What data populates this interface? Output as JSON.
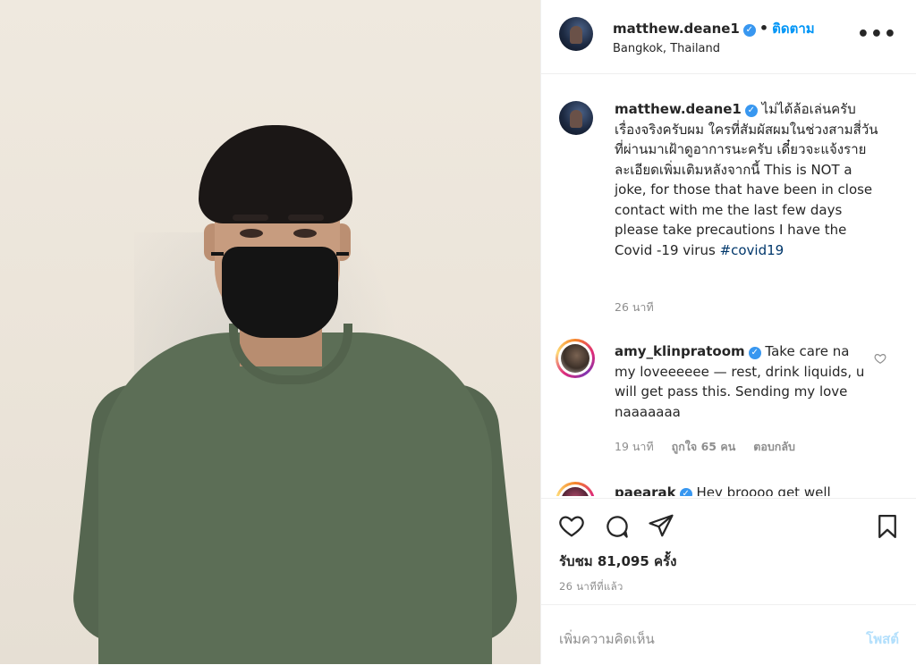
{
  "post": {
    "username": "matthew.deane1",
    "follow_label": "ติดตาม",
    "separator": "•",
    "location": "Bangkok, Thailand",
    "more_label": "•••",
    "caption_prefix": "ไม่ได้ล้อเล่นครับ เรื่องจริงครับผม ใครที่สัมผัสผมในช่วงสามสี่วันที่ผ่านมาเฝ้าดูอาการนะครับ เดี๋ยวจะแจ้งรายละเอียดเพิ่มเติมหลังจากนี้ This is NOT a joke, for those that have been in close contact with me the last few days please take precautions I have the Covid -19 virus ",
    "hashtag": "#covid19",
    "caption_time": "26 นาที",
    "verified_icon": "✓"
  },
  "comments": [
    {
      "username": "amy_klinpratoom",
      "text": "Take care na my loveeeeee — rest, drink liquids, u will get pass this. Sending my love naaaaaaa",
      "time": "19 นาที",
      "likes": "ถูกใจ 65 คน",
      "reply": "ตอบกลับ"
    },
    {
      "username": "paearak",
      "text": "Hey broooo get well"
    }
  ],
  "actions": {
    "icons": [
      "heart-icon",
      "comment-icon",
      "share-icon",
      "bookmark-icon"
    ],
    "views": "รับชม 81,095 ครั้ง",
    "posted": "26 นาทีที่แล้ว"
  },
  "add_comment": {
    "placeholder": "เพิ่มความคิดเห็น",
    "post_label": "โพสต์"
  },
  "colors": {
    "link": "#0095f6",
    "verified": "#3897f0",
    "muted": "#8e8e8e",
    "post_disabled": "#b2dffc"
  }
}
